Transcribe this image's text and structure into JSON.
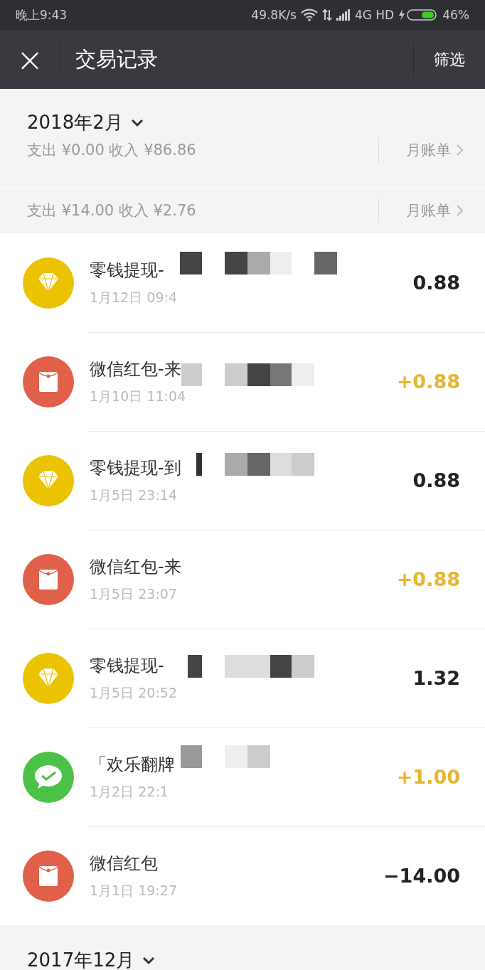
{
  "status_bar": {
    "time": "晚上9:43",
    "speed": "49.8K/s",
    "network": "4G HD",
    "battery": "46%"
  },
  "header": {
    "close": "×",
    "title": "交易记录",
    "filter": "筛选"
  },
  "months": [
    {
      "label": "2018年2月",
      "summary": "支出 ¥0.00 收入 ¥86.86",
      "bill": "月账单"
    },
    {
      "summary": "支出 ¥14.00 收入 ¥2.76",
      "bill": "月账单"
    }
  ],
  "transactions": [
    {
      "kind": "diamond",
      "title": "零钱提现-",
      "time": "1月12日 09:4",
      "amount": "0.88",
      "income": false
    },
    {
      "kind": "redpacket",
      "title": "微信红包-来",
      "time": "1月10日 11:04",
      "amount": "+0.88",
      "income": true
    },
    {
      "kind": "diamond",
      "title": "零钱提现-到",
      "time": "1月5日 23:14",
      "amount": "0.88",
      "income": false
    },
    {
      "kind": "redpacket",
      "title": "微信红包-来",
      "time": "1月5日 23:07",
      "amount": "+0.88",
      "income": true
    },
    {
      "kind": "diamond",
      "title": "零钱提现-",
      "time": "1月5日 20:52",
      "amount": "1.32",
      "income": false
    },
    {
      "kind": "wechat",
      "title": "「欢乐翻牌",
      "time": "1月2日 22:1",
      "amount": "+1.00",
      "income": true
    },
    {
      "kind": "redpacket",
      "title": "微信红包",
      "time": "1月1日 19:27",
      "amount": "−14.00",
      "income": false
    }
  ],
  "next_month": {
    "label": "2017年12月"
  }
}
